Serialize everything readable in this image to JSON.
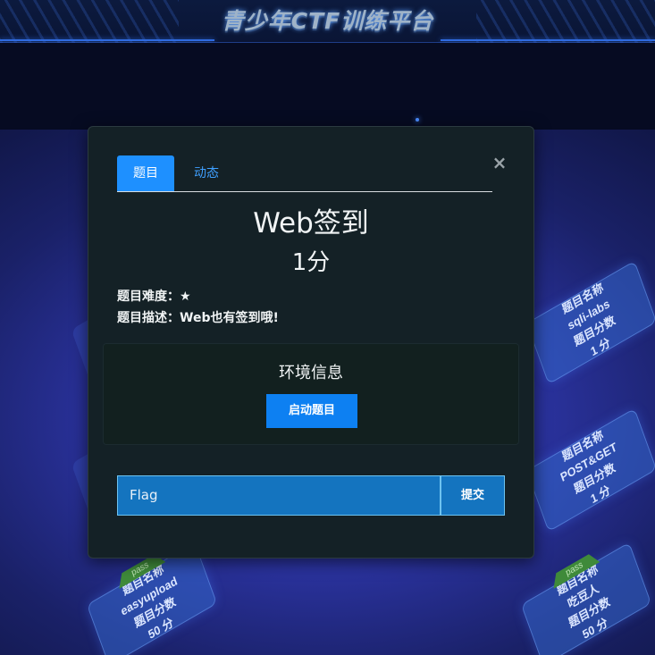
{
  "site": {
    "title": "青少年CTF训练平台"
  },
  "challenge_cards": [
    {
      "name_label": "题目名称",
      "name": "sqli-labs",
      "points_label": "题目分数",
      "points": "1 分",
      "pass": ""
    },
    {
      "name_label": "题目名称",
      "name": "POST&GET",
      "points_label": "题目分数",
      "points": "1 分",
      "pass": ""
    },
    {
      "name_label": "题目名称",
      "name": "easyupload",
      "points_label": "题目分数",
      "points": "50 分",
      "pass": "pass"
    },
    {
      "name_label": "题目名称",
      "name": "吃豆人",
      "points_label": "题目分数",
      "points": "50 分",
      "pass": "pass"
    }
  ],
  "modal": {
    "close_symbol": "×",
    "tabs": [
      {
        "label": "题目",
        "active": true
      },
      {
        "label": "动态",
        "active": false
      }
    ],
    "challenge_title": "Web签到",
    "challenge_points": "1分",
    "difficulty": "题目难度：★",
    "description": "题目描述：Web也有签到哦!",
    "environment": {
      "title": "环境信息",
      "start_button": "启动题目"
    },
    "flag_input": {
      "placeholder": "Flag",
      "value": ""
    },
    "submit_button": "提交"
  },
  "colors": {
    "modal_bg": "#142126",
    "tab_active": "#1e90ff",
    "tab_inactive_text": "#3fa0ff",
    "start_button": "#0d80f2",
    "flag_input_bg": "#1474bf"
  }
}
